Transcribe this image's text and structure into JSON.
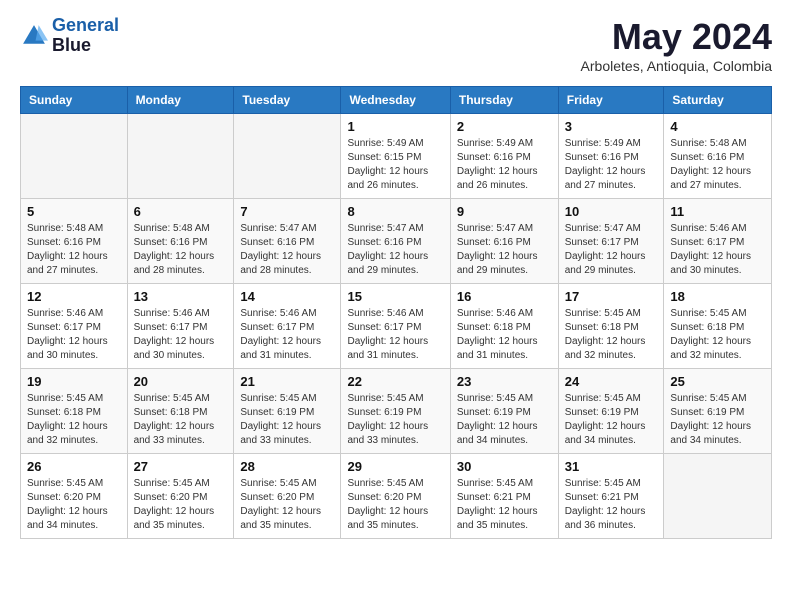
{
  "header": {
    "logo_line1": "General",
    "logo_line2": "Blue",
    "title": "May 2024",
    "subtitle": "Arboletes, Antioquia, Colombia"
  },
  "days_of_week": [
    "Sunday",
    "Monday",
    "Tuesday",
    "Wednesday",
    "Thursday",
    "Friday",
    "Saturday"
  ],
  "weeks": [
    [
      {
        "day": "",
        "info": ""
      },
      {
        "day": "",
        "info": ""
      },
      {
        "day": "",
        "info": ""
      },
      {
        "day": "1",
        "info": "Sunrise: 5:49 AM\nSunset: 6:15 PM\nDaylight: 12 hours and 26 minutes."
      },
      {
        "day": "2",
        "info": "Sunrise: 5:49 AM\nSunset: 6:16 PM\nDaylight: 12 hours and 26 minutes."
      },
      {
        "day": "3",
        "info": "Sunrise: 5:49 AM\nSunset: 6:16 PM\nDaylight: 12 hours and 27 minutes."
      },
      {
        "day": "4",
        "info": "Sunrise: 5:48 AM\nSunset: 6:16 PM\nDaylight: 12 hours and 27 minutes."
      }
    ],
    [
      {
        "day": "5",
        "info": "Sunrise: 5:48 AM\nSunset: 6:16 PM\nDaylight: 12 hours and 27 minutes."
      },
      {
        "day": "6",
        "info": "Sunrise: 5:48 AM\nSunset: 6:16 PM\nDaylight: 12 hours and 28 minutes."
      },
      {
        "day": "7",
        "info": "Sunrise: 5:47 AM\nSunset: 6:16 PM\nDaylight: 12 hours and 28 minutes."
      },
      {
        "day": "8",
        "info": "Sunrise: 5:47 AM\nSunset: 6:16 PM\nDaylight: 12 hours and 29 minutes."
      },
      {
        "day": "9",
        "info": "Sunrise: 5:47 AM\nSunset: 6:16 PM\nDaylight: 12 hours and 29 minutes."
      },
      {
        "day": "10",
        "info": "Sunrise: 5:47 AM\nSunset: 6:17 PM\nDaylight: 12 hours and 29 minutes."
      },
      {
        "day": "11",
        "info": "Sunrise: 5:46 AM\nSunset: 6:17 PM\nDaylight: 12 hours and 30 minutes."
      }
    ],
    [
      {
        "day": "12",
        "info": "Sunrise: 5:46 AM\nSunset: 6:17 PM\nDaylight: 12 hours and 30 minutes."
      },
      {
        "day": "13",
        "info": "Sunrise: 5:46 AM\nSunset: 6:17 PM\nDaylight: 12 hours and 30 minutes."
      },
      {
        "day": "14",
        "info": "Sunrise: 5:46 AM\nSunset: 6:17 PM\nDaylight: 12 hours and 31 minutes."
      },
      {
        "day": "15",
        "info": "Sunrise: 5:46 AM\nSunset: 6:17 PM\nDaylight: 12 hours and 31 minutes."
      },
      {
        "day": "16",
        "info": "Sunrise: 5:46 AM\nSunset: 6:18 PM\nDaylight: 12 hours and 31 minutes."
      },
      {
        "day": "17",
        "info": "Sunrise: 5:45 AM\nSunset: 6:18 PM\nDaylight: 12 hours and 32 minutes."
      },
      {
        "day": "18",
        "info": "Sunrise: 5:45 AM\nSunset: 6:18 PM\nDaylight: 12 hours and 32 minutes."
      }
    ],
    [
      {
        "day": "19",
        "info": "Sunrise: 5:45 AM\nSunset: 6:18 PM\nDaylight: 12 hours and 32 minutes."
      },
      {
        "day": "20",
        "info": "Sunrise: 5:45 AM\nSunset: 6:18 PM\nDaylight: 12 hours and 33 minutes."
      },
      {
        "day": "21",
        "info": "Sunrise: 5:45 AM\nSunset: 6:19 PM\nDaylight: 12 hours and 33 minutes."
      },
      {
        "day": "22",
        "info": "Sunrise: 5:45 AM\nSunset: 6:19 PM\nDaylight: 12 hours and 33 minutes."
      },
      {
        "day": "23",
        "info": "Sunrise: 5:45 AM\nSunset: 6:19 PM\nDaylight: 12 hours and 34 minutes."
      },
      {
        "day": "24",
        "info": "Sunrise: 5:45 AM\nSunset: 6:19 PM\nDaylight: 12 hours and 34 minutes."
      },
      {
        "day": "25",
        "info": "Sunrise: 5:45 AM\nSunset: 6:19 PM\nDaylight: 12 hours and 34 minutes."
      }
    ],
    [
      {
        "day": "26",
        "info": "Sunrise: 5:45 AM\nSunset: 6:20 PM\nDaylight: 12 hours and 34 minutes."
      },
      {
        "day": "27",
        "info": "Sunrise: 5:45 AM\nSunset: 6:20 PM\nDaylight: 12 hours and 35 minutes."
      },
      {
        "day": "28",
        "info": "Sunrise: 5:45 AM\nSunset: 6:20 PM\nDaylight: 12 hours and 35 minutes."
      },
      {
        "day": "29",
        "info": "Sunrise: 5:45 AM\nSunset: 6:20 PM\nDaylight: 12 hours and 35 minutes."
      },
      {
        "day": "30",
        "info": "Sunrise: 5:45 AM\nSunset: 6:21 PM\nDaylight: 12 hours and 35 minutes."
      },
      {
        "day": "31",
        "info": "Sunrise: 5:45 AM\nSunset: 6:21 PM\nDaylight: 12 hours and 36 minutes."
      },
      {
        "day": "",
        "info": ""
      }
    ]
  ]
}
